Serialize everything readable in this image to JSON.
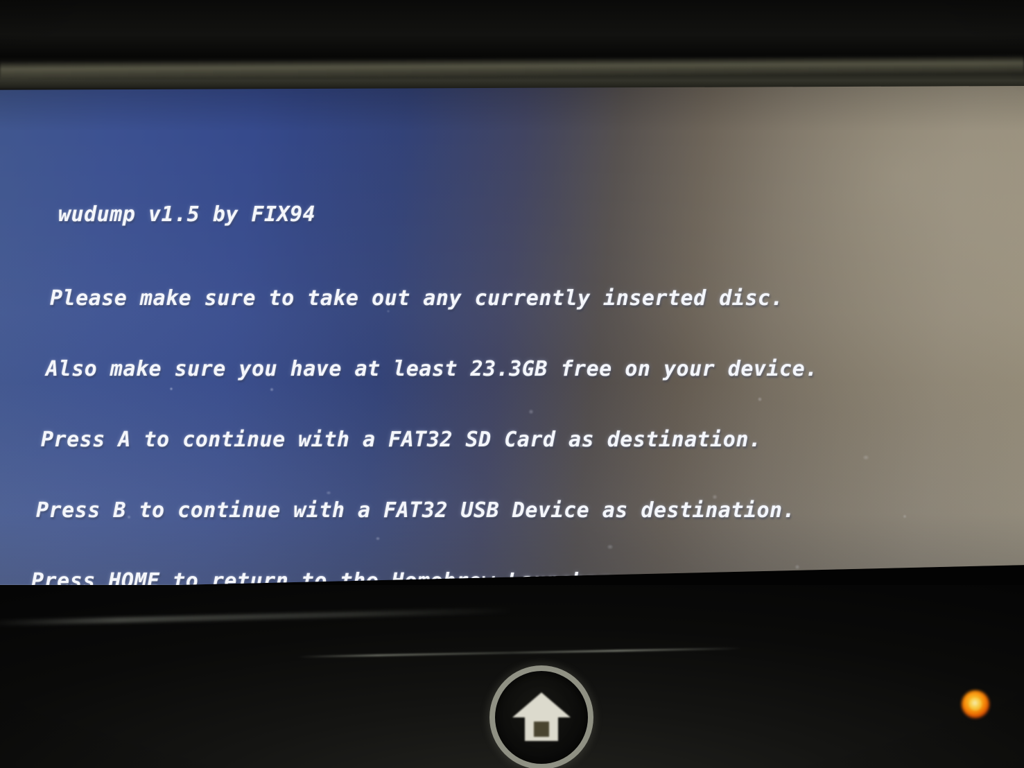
{
  "device": {
    "label": "nintendo-wii-u-gamepad",
    "screen_background_color": "#3c5191",
    "screen_text_color": "#f4f6fb",
    "led_color": "#ff8a06",
    "home_button_label": "HOME",
    "home_icon": "house-icon",
    "led_label": "power-led"
  },
  "console": {
    "title": "wudump v1.5 by FIX94",
    "lines": [
      "Please make sure to take out any currently inserted disc.",
      "Also make sure you have at least 23.3GB free on your device.",
      "Press A to continue with a FAT32 SD Card as destination.",
      "Press B to continue with a FAT32 USB Device as destination.",
      "Press HOME to return to the Homebrew Launcher."
    ],
    "app_name": "wudump",
    "version": "v1.5",
    "author": "FIX94",
    "required_free_space": "23.3GB",
    "options": [
      {
        "button": "A",
        "destination": "FAT32 SD Card"
      },
      {
        "button": "B",
        "destination": "FAT32 USB Device"
      },
      {
        "button": "HOME",
        "destination": "Homebrew Launcher"
      }
    ]
  }
}
